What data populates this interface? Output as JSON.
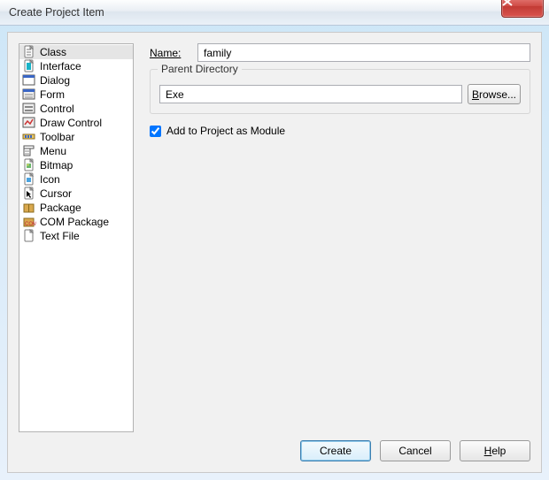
{
  "window": {
    "title": "Create Project Item",
    "close_tooltip": "Close"
  },
  "sidebar": {
    "items": [
      {
        "label": "Class",
        "icon": "class-icon",
        "selected": true
      },
      {
        "label": "Interface",
        "icon": "interface-icon",
        "selected": false
      },
      {
        "label": "Dialog",
        "icon": "dialog-icon",
        "selected": false
      },
      {
        "label": "Form",
        "icon": "form-icon",
        "selected": false
      },
      {
        "label": "Control",
        "icon": "control-icon",
        "selected": false
      },
      {
        "label": "Draw Control",
        "icon": "drawcontrol-icon",
        "selected": false
      },
      {
        "label": "Toolbar",
        "icon": "toolbar-icon",
        "selected": false
      },
      {
        "label": "Menu",
        "icon": "menu-icon",
        "selected": false
      },
      {
        "label": "Bitmap",
        "icon": "bitmap-icon",
        "selected": false
      },
      {
        "label": "Icon",
        "icon": "icon-icon",
        "selected": false
      },
      {
        "label": "Cursor",
        "icon": "cursor-icon",
        "selected": false
      },
      {
        "label": "Package",
        "icon": "package-icon",
        "selected": false
      },
      {
        "label": "COM Package",
        "icon": "compackage-icon",
        "selected": false
      },
      {
        "label": "Text File",
        "icon": "textfile-icon",
        "selected": false
      }
    ]
  },
  "form": {
    "name_label": "Name:",
    "name_value": "family",
    "parent_dir_label": "Parent Directory",
    "parent_dir_value": "Exe",
    "browse_label": "Browse...",
    "module_checkbox_label": "Add to Project as Module",
    "module_checked": true
  },
  "buttons": {
    "create": "Create",
    "cancel": "Cancel",
    "help": "Help"
  }
}
